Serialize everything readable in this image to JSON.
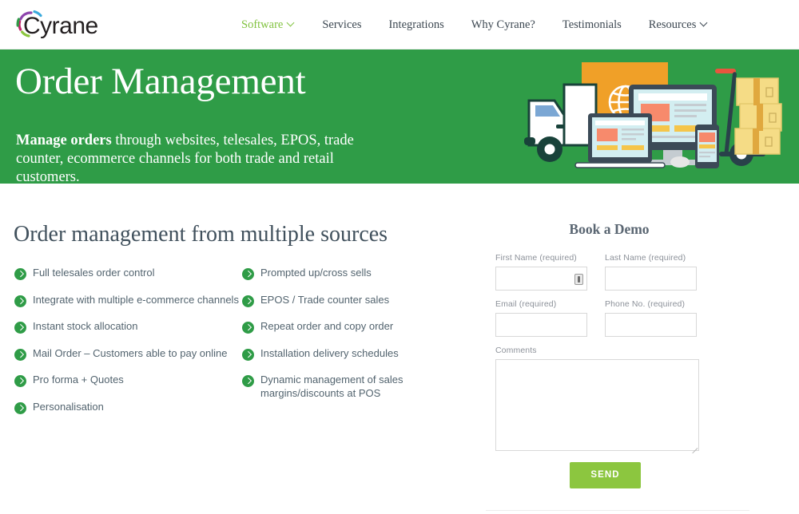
{
  "header": {
    "logo_text": "Cyrane",
    "logo_colors": [
      "#8e44ad",
      "#2f9c47",
      "#3aa9dc",
      "#c2256b",
      "#8cc63f"
    ],
    "nav": [
      {
        "label": "Software",
        "active": true,
        "has_chevron": true,
        "name": "nav-item-software"
      },
      {
        "label": "Services",
        "active": false,
        "has_chevron": false,
        "name": "nav-item-services"
      },
      {
        "label": "Integrations",
        "active": false,
        "has_chevron": false,
        "name": "nav-item-integrations"
      },
      {
        "label": "Why Cyrane?",
        "active": false,
        "has_chevron": false,
        "name": "nav-item-why-cyrane"
      },
      {
        "label": "Testimonials",
        "active": false,
        "has_chevron": false,
        "name": "nav-item-testimonials"
      },
      {
        "label": "Resources",
        "active": false,
        "has_chevron": true,
        "name": "nav-item-resources"
      }
    ]
  },
  "hero": {
    "title": "Order Management",
    "subtitle_bold": "Manage orders",
    "subtitle_rest": " through websites, telesales, EPOS, trade counter, ecommerce channels for both trade and retail customers.",
    "background_color": "#2f9c47",
    "illustration": "delivery-truck-devices-boxes-illustration"
  },
  "main": {
    "section_title": "Order management from multiple sources",
    "bullets_left": [
      "Full telesales order control",
      "Integrate with multiple e-commerce channels",
      "Instant stock allocation",
      "Mail Order – Customers able to pay online",
      "Pro forma + Quotes",
      "Personalisation"
    ],
    "bullets_right": [
      "Prompted up/cross sells",
      "EPOS / Trade counter sales",
      "Repeat order and copy order",
      "Installation delivery schedules",
      "Dynamic management of sales margins/discounts at POS"
    ],
    "bullet_icon": "chevron-right-circle-icon",
    "bullet_icon_color": "#2f9c47"
  },
  "form": {
    "title": "Book a Demo",
    "fields": {
      "first_name": {
        "label": "First Name (required)",
        "value": "",
        "placeholder": ""
      },
      "last_name": {
        "label": "Last Name (required)",
        "value": "",
        "placeholder": ""
      },
      "email": {
        "label": "Email (required)",
        "value": "",
        "placeholder": ""
      },
      "phone": {
        "label": "Phone No. (required)",
        "value": "",
        "placeholder": ""
      },
      "comments": {
        "label": "Comments",
        "value": "",
        "placeholder": ""
      }
    },
    "autofill_icon": "autofill-icon",
    "submit_label": "SEND",
    "submit_color": "#8cc63f"
  }
}
